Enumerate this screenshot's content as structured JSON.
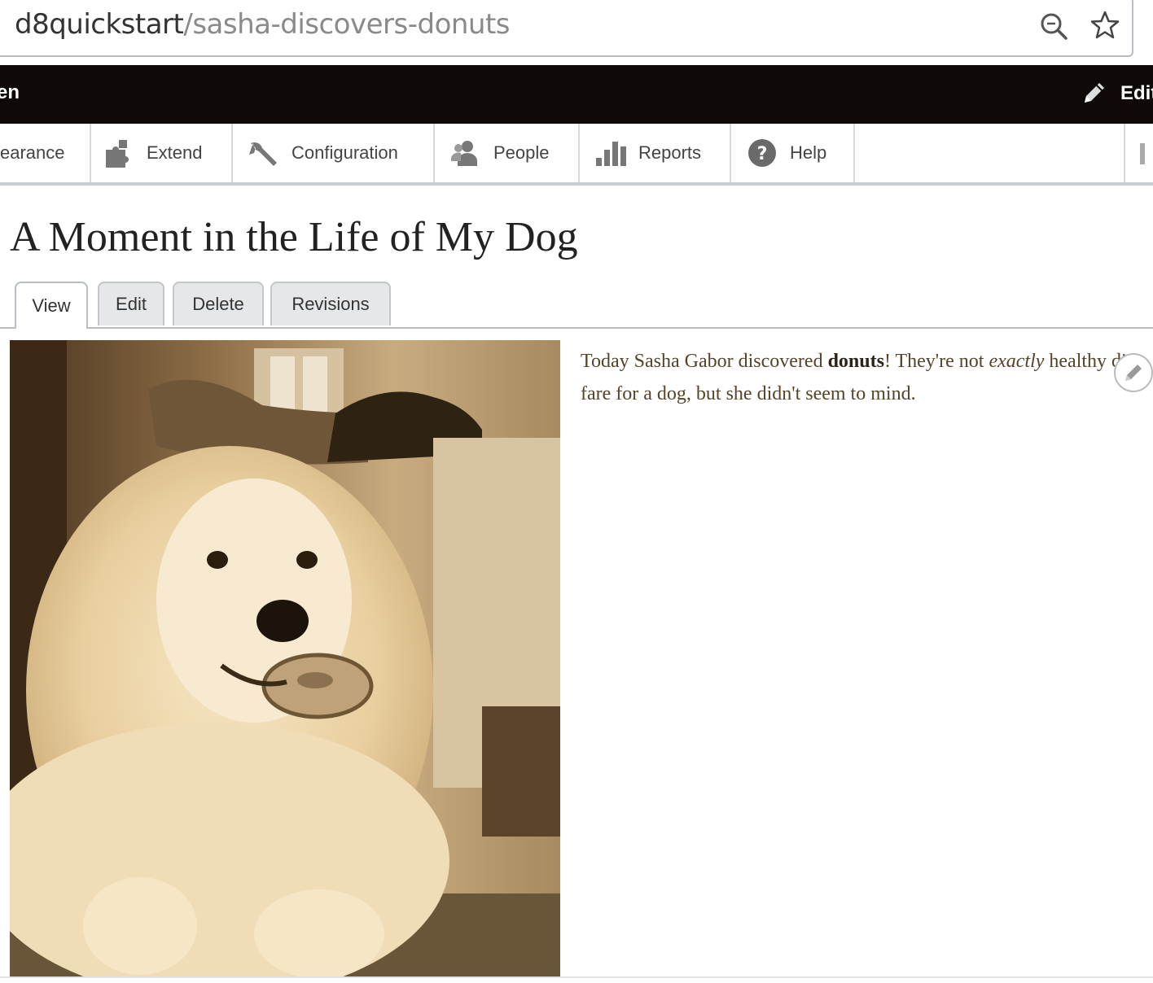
{
  "browser": {
    "url_host": "d8quickstart",
    "url_path": "/sasha-discovers-donuts",
    "icons": [
      "zoom-icon",
      "bookmark-star-icon"
    ]
  },
  "toolbar": {
    "left_label": "en",
    "edit_label": "Edit",
    "edit_icon": "pencil-icon"
  },
  "tray": {
    "items": [
      {
        "label": "earance",
        "icon": ""
      },
      {
        "label": "Extend",
        "icon": "puzzle-icon"
      },
      {
        "label": "Configuration",
        "icon": "wrench-icon"
      },
      {
        "label": "People",
        "icon": "people-icon"
      },
      {
        "label": "Reports",
        "icon": "bar-chart-icon"
      },
      {
        "label": "Help",
        "icon": "help-icon"
      }
    ]
  },
  "page": {
    "title": "A Moment in the Life of My Dog",
    "tabs": [
      {
        "label": "View",
        "active": true
      },
      {
        "label": "Edit",
        "active": false
      },
      {
        "label": "Delete",
        "active": false
      },
      {
        "label": "Revisions",
        "active": false
      }
    ],
    "body": {
      "part1": "Today Sasha Gabor discovered ",
      "bold": "donuts",
      "part2": "! They're not ",
      "italic": "exactly",
      "part3": " healthy diet fare for a dog, but she didn't seem to mind."
    }
  },
  "colors": {
    "toolbar_bg": "#0f0a08",
    "body_text": "#55432a",
    "photo_tone": "#c9a874"
  }
}
